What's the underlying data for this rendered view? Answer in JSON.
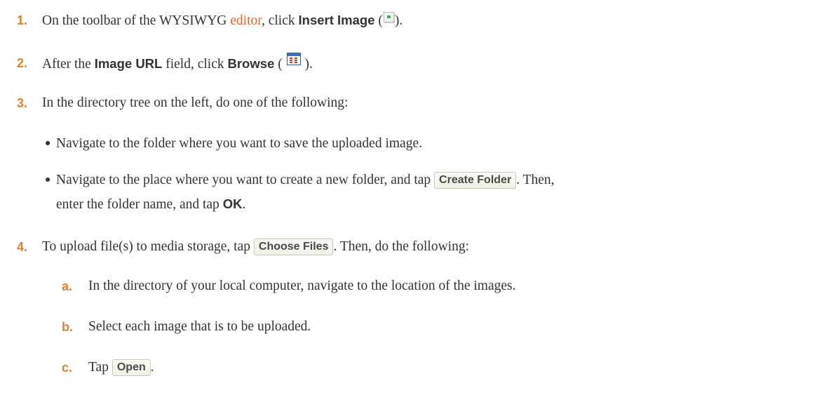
{
  "steps": [
    {
      "num": "1.",
      "pre": "On the toolbar of the WYSIWYG ",
      "link": "editor",
      "mid": ", click ",
      "bold": "Insert Image",
      "open": " (",
      "close": ")."
    },
    {
      "num": "2.",
      "pre": "After the ",
      "bold1": "Image URL",
      "mid": " field, click ",
      "bold2": "Browse",
      "open": " ( ",
      "close": " )."
    },
    {
      "num": "3.",
      "text": "In the directory tree on the left, do one of the following:",
      "bullets": [
        {
          "text": "Navigate to the folder where you want to save the uploaded image."
        },
        {
          "pre": "Navigate to the place where you want to create a new folder, and tap ",
          "button": "Create Folder",
          "post": ". Then,",
          "line2_pre": "enter the folder name, and tap ",
          "line2_bold": "OK",
          "line2_post": "."
        }
      ]
    },
    {
      "num": "4.",
      "pre": "To upload file(s) to media storage, tap ",
      "button": "Choose Files",
      "post": ". Then, do the following:",
      "substeps": [
        {
          "letter": "a.",
          "text": "In the directory of your local computer, navigate to the location of the images."
        },
        {
          "letter": "b.",
          "text": "Select each image that is to be uploaded."
        },
        {
          "letter": "c.",
          "pre": "Tap ",
          "button": "Open",
          "post": "."
        }
      ]
    }
  ],
  "icons": {
    "insert_image": "insert-image-icon",
    "browse": "browse-icon"
  },
  "colors": {
    "number": "#e0822d",
    "link": "#d9662b",
    "text": "#333333"
  }
}
